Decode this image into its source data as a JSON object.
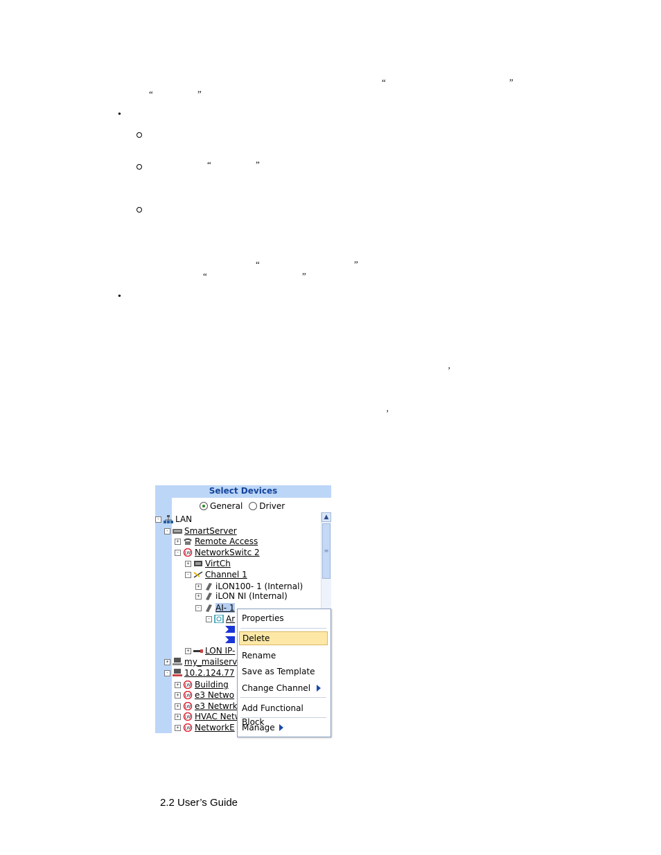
{
  "quotes": {
    "q1_open": "“",
    "q1_close": "”",
    "q2_open": "“",
    "q2_close": "”",
    "q3_open": "“",
    "q3_close": "”",
    "q4_open": "“",
    "q4_close": "”",
    "q5_open": "“",
    "q5_close": "”",
    "comma1": "’",
    "comma2": "’"
  },
  "bullets": {
    "dot": "•"
  },
  "panel": {
    "title": "Select Devices",
    "radio_general": "General",
    "radio_driver": "Driver",
    "tree": [
      {
        "label": "LAN"
      },
      {
        "label": "SmartServer"
      },
      {
        "label": "Remote Access"
      },
      {
        "label": "NetworkSwitc 2"
      },
      {
        "label": "VirtCh"
      },
      {
        "label": "Channel 1"
      },
      {
        "label": "iLON100- 1 (Internal)"
      },
      {
        "label": "iLON NI (Internal)"
      },
      {
        "label": "AI- 1"
      },
      {
        "label": "Ar"
      },
      {
        "label": "LON IP-"
      },
      {
        "label": "my_mailserv"
      },
      {
        "label": "10.2.124.77"
      },
      {
        "label": "Building"
      },
      {
        "label": "e3 Netwo"
      },
      {
        "label": "e3 Netwrk"
      },
      {
        "label": "HVAC Netw"
      },
      {
        "label": "NetworkE"
      }
    ]
  },
  "context_menu": {
    "items": [
      {
        "label": "Properties"
      },
      {
        "label": "Delete"
      },
      {
        "label": "Rename"
      },
      {
        "label": "Save as Template"
      },
      {
        "label": "Change Channel"
      },
      {
        "label": "Add Functional Block"
      },
      {
        "label": "Manage"
      }
    ]
  },
  "footer": {
    "text": "2.2 User’s Guide"
  }
}
